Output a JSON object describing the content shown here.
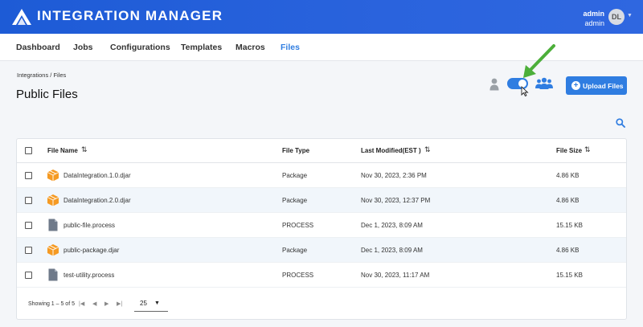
{
  "header": {
    "title": "INTEGRATION MANAGER",
    "user_name": "admin",
    "user_role": "admin",
    "avatar_initials": "DL",
    "brand_color": "#1d5bd6"
  },
  "nav": {
    "items": [
      "Dashboard",
      "Jobs",
      "Configurations",
      "Templates",
      "Macros",
      "Files"
    ],
    "active": "Files"
  },
  "breadcrumb": "Integrations / Files",
  "page_title": "Public Files",
  "toolbar": {
    "upload_label": "Upload Files",
    "toggle_on": true,
    "accent_color": "#2f7de1"
  },
  "table": {
    "columns": [
      "File Name",
      "File Type",
      "Last Modified(EST )",
      "File Size"
    ],
    "rows": [
      {
        "icon": "package-icon",
        "name": "DataIntegration.1.0.djar",
        "type": "Package",
        "modified": "Nov 30, 2023, 2:36 PM",
        "size": "4.86 KB"
      },
      {
        "icon": "package-icon",
        "name": "DataIntegration.2.0.djar",
        "type": "Package",
        "modified": "Nov 30, 2023, 12:37 PM",
        "size": "4.86 KB"
      },
      {
        "icon": "document-icon",
        "name": "public-file.process",
        "type": "PROCESS",
        "modified": "Dec 1, 2023, 8:09 AM",
        "size": "15.15 KB"
      },
      {
        "icon": "package-icon",
        "name": "public-package.djar",
        "type": "Package",
        "modified": "Dec 1, 2023, 8:09 AM",
        "size": "4.86 KB"
      },
      {
        "icon": "document-icon",
        "name": "test-utility.process",
        "type": "PROCESS",
        "modified": "Nov 30, 2023, 11:17 AM",
        "size": "15.15 KB"
      }
    ]
  },
  "pagination": {
    "summary": "Showing 1 – 5 of 5",
    "page_size": "25"
  }
}
